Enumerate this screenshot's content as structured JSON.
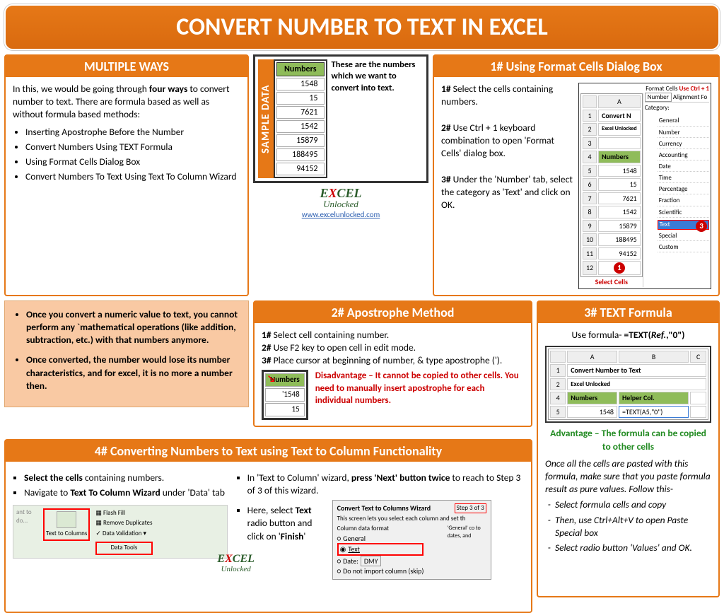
{
  "title": "CONVERT NUMBER TO TEXT IN EXCEL",
  "multipleWays": {
    "header": "MULTIPLE WAYS",
    "intro1": "In this, we would be going through ",
    "introBold": "four ways",
    "intro2": " to convert number to text. There are formula based as well as without formula based methods:",
    "items": [
      "Inserting Apostrophe Before the Number",
      "Convert Numbers Using TEXT Formula",
      "Using Format Cells Dialog Box",
      "Convert Numbers To Text Using Text To Column Wizard"
    ]
  },
  "sample": {
    "label": "SAMPLE DATA",
    "colHeader": "Numbers",
    "values": [
      "1548",
      "15",
      "7621",
      "1542",
      "15879",
      "188495",
      "94152"
    ],
    "caption": "These are the numbers which we want to convert into text.",
    "logoLine1": "E CEL",
    "logoLine2": "Unlocked",
    "logoX": "X",
    "url": "www.excelunlocked.com"
  },
  "method1": {
    "header": "1# Using Format Cells Dialog Box",
    "step1b": "1#",
    "step1": " Select the cells containing numbers.",
    "step2b": "2#",
    "step2": " Use Ctrl + 1 keyboard combination to open 'Format Cells' dialog box.",
    "step3b": "3#",
    "step3": " Under the 'Number' tab, select the category as 'Text' and click on OK.",
    "imgTitle1": "Convert N",
    "imgTitle2": "Excel Unlocked",
    "tabFormat": "Format Cells",
    "tabHint": "Use Ctrl + 1",
    "tabNumber": "Number",
    "tabAlign": "Alignment",
    "tabFont": "Fo",
    "catLabel": "Category:",
    "cats": [
      "General",
      "Number",
      "Currency",
      "Accounting",
      "Date",
      "Time",
      "Percentage",
      "Fraction",
      "Scientific",
      "Text",
      "Special",
      "Custom"
    ],
    "selectCells": "Select Cells"
  },
  "notes": {
    "n1": "Once you convert a numeric value to text, you cannot perform any `mathematical operations (like addition, subtraction, etc.) with that numbers anymore.",
    "n2": "Once converted, the number would lose its number characteristics, and for excel, it is no more a number then."
  },
  "method2": {
    "header": "2# Apostrophe Method",
    "s1b": "1#",
    "s1": " Select cell containing number.",
    "s2b": "2#",
    "s2": " Use F2 key to open cell in edit mode.",
    "s3b": "3#",
    "s3": " Place cursor at beginning of number, & type apostrophe (').",
    "disB": "Disadvantage – It cannot be copied to other cells. You need to manually insert apostrophe for each individual numbers.",
    "tblHead": "Numbers",
    "tblV1": "'1548",
    "tblV2": "15"
  },
  "method3": {
    "header": "3# TEXT Formula",
    "formulaLabel": "Use formula-  ",
    "formula1": "=TEXT(",
    "formulaRef": "Ref.",
    "formula2": ",\"0\")",
    "imgTitle": "Convert Number to Text",
    "imgSub": "Excel Unlocked",
    "colA": "Numbers",
    "colB": "Helper Col.",
    "valA": "1548",
    "valB": "=TEXT(A5,\"0\")",
    "adv": "Advantage – The formula can be copied to other cells",
    "note": "Once all the cells are pasted with this formula, make sure that you paste formula result as pure values. Follow this-",
    "steps": [
      "Select formula cells and copy",
      "Then, use Ctrl+Alt+V to open Paste Special box",
      "Select radio button 'Values' and OK."
    ]
  },
  "method4": {
    "header": "4# Converting Numbers to Text using Text to Column Functionality",
    "leftHead": "Select the cells",
    "leftTail": " containing numbers.",
    "left2a": "Navigate to ",
    "left2b": "Text To Column Wizard",
    "left2c": " under 'Data' tab",
    "right1a": "In 'Text to Column' wizard, ",
    "right1b": "press 'Next' button twice",
    "right1c": " to reach to Step 3 of 3 of this wizard.",
    "right2a": "Here, select ",
    "right2b": "Text",
    "right2c": " radio button and click on '",
    "right2d": "Finish",
    "right2e": "'",
    "ribbonHint": "ant to do...",
    "ribbonMain": "Text to Columns",
    "ribbonFlash": "Flash Fill",
    "ribbonDup": "Remove Duplicates",
    "ribbonVal": "Data Validation",
    "ribbonGroup": "Data Tools",
    "wizTitle": "Convert Text to Columns Wizard",
    "wizStep": "Step 3 of 3",
    "wizDesc": "This screen lets you select each column and set th",
    "wizSection": "Column data format",
    "optGen": "General",
    "optText": "Text",
    "optDate": "Date:",
    "optDateV": "DMY",
    "optSkip": "Do not import column (skip)",
    "wizNote": "'General' co to dates, and"
  }
}
